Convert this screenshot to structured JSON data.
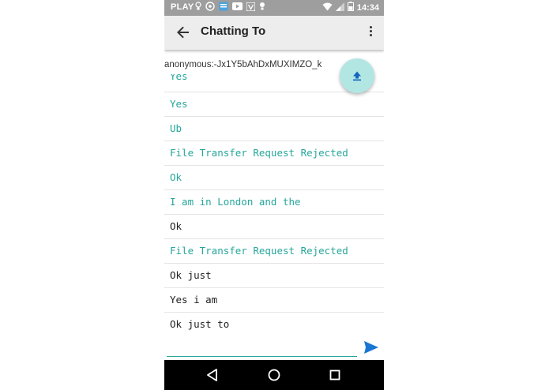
{
  "status_bar": {
    "carrier": "PLAY",
    "time": "14:34",
    "icons": [
      "bulb-icon",
      "soccer-icon",
      "app-icon",
      "youtube-icon",
      "vine-icon",
      "bulb-icon",
      "wifi-icon",
      "signal-icon",
      "battery-icon"
    ]
  },
  "app_bar": {
    "title": "Chatting To",
    "back_icon": "arrow-left-icon",
    "menu_icon": "more-vert-icon"
  },
  "peer": {
    "name": "anonymous:-Jx1Y5bAhDxMUXIMZO_k"
  },
  "messages": [
    {
      "text": "Yes",
      "sender": "incoming",
      "partial": true
    },
    {
      "text": "Yes",
      "sender": "incoming"
    },
    {
      "text": "Ub",
      "sender": "incoming"
    },
    {
      "text": "File Transfer Request Rejected",
      "sender": "incoming"
    },
    {
      "text": "Ok",
      "sender": "incoming"
    },
    {
      "text": "I am in London and the",
      "sender": "incoming"
    },
    {
      "text": "Ok",
      "sender": "outgoing"
    },
    {
      "text": "File Transfer Request Rejected",
      "sender": "incoming"
    },
    {
      "text": "Ok just",
      "sender": "outgoing"
    },
    {
      "text": "Yes i am",
      "sender": "outgoing"
    },
    {
      "text": "Ok just to",
      "sender": "outgoing"
    }
  ],
  "composer": {
    "value": "",
    "placeholder": ""
  },
  "fab": {
    "icon": "upload-icon"
  },
  "colors": {
    "accent": "#26a69a",
    "fab": "#b2e6e3",
    "send": "#1976d2",
    "status_bar": "#9e9e9e",
    "app_bar": "#ededed"
  },
  "nav": {
    "icons": [
      "back-triangle-icon",
      "home-circle-icon",
      "recents-square-icon"
    ]
  }
}
